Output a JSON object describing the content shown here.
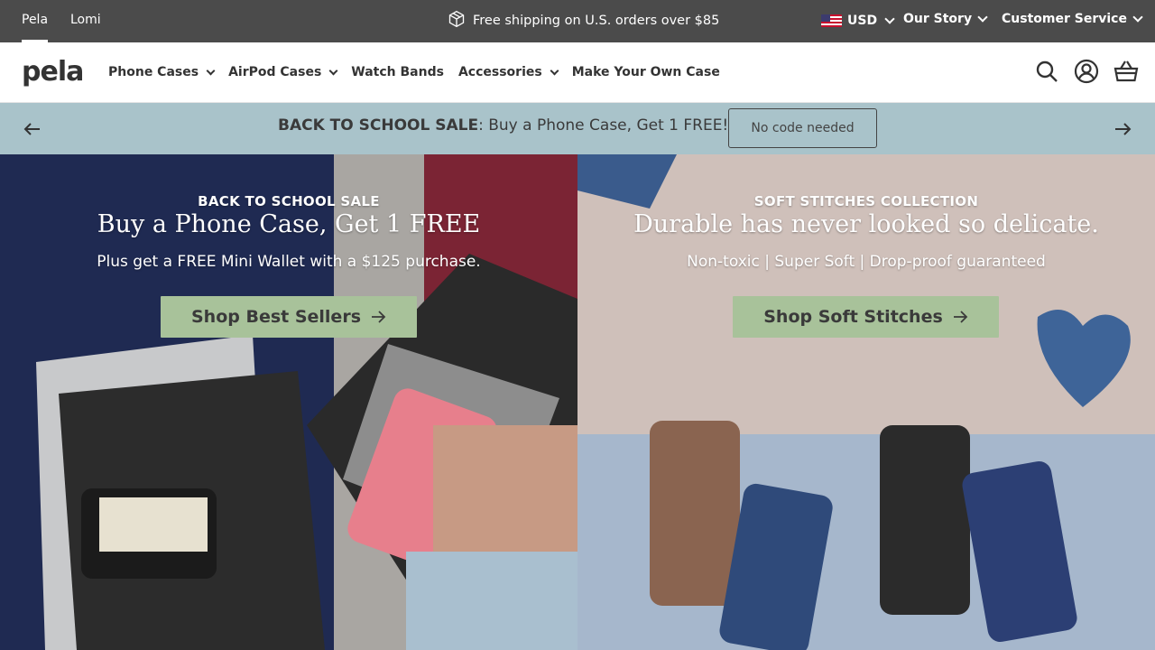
{
  "topbar": {
    "brands": [
      "Pela",
      "Lomi"
    ],
    "promo_text": "Free shipping on U.S. orders over $85",
    "currency": "USD",
    "our_story": "Our Story",
    "customer_service": "Customer Service"
  },
  "nav": {
    "logo": "pela",
    "links": [
      "Phone Cases",
      "AirPod Cases",
      "Watch Bands",
      "Accessories",
      "Make Your Own Case"
    ]
  },
  "announcement": {
    "bold": "BACK TO SCHOOL SALE",
    "text": ": Buy a Phone Case, Get 1 FREE!",
    "code_label": "No code needed"
  },
  "hero_left": {
    "eyebrow": "BACK TO SCHOOL SALE",
    "headline": "Buy a Phone Case, Get 1 FREE",
    "subline": "Plus get a FREE Mini Wallet with a $125 purchase.",
    "cta": "Shop Best Sellers"
  },
  "hero_right": {
    "eyebrow": "SOFT STITCHES COLLECTION",
    "headline": "Durable has never looked so delicate.",
    "subline": "Non-toxic | Super Soft | Drop-proof guaranteed",
    "cta": "Shop Soft Stitches"
  },
  "colors": {
    "topbar_bg": "#4b4b4b",
    "announcement_bg": "#a9c3ca",
    "cta_bg": "#a8c29a"
  }
}
